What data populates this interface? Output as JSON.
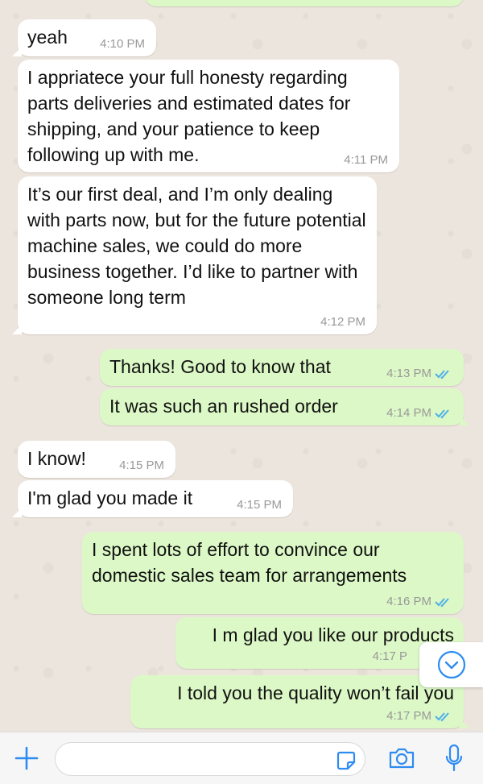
{
  "colors": {
    "background": "#ece5dd",
    "incoming_bubble": "#ffffff",
    "outgoing_bubble": "#dcf8c6",
    "read_ticks": "#4fb0e8",
    "accent": "#2d8cf0"
  },
  "messages": [
    {
      "direction": "in",
      "text": "yeah",
      "time": "4:10 PM"
    },
    {
      "direction": "in",
      "text": "I appriatece your full honesty regarding parts deliveries and estimated dates for shipping, and your patience to keep following up with me.",
      "time": "4:11 PM"
    },
    {
      "direction": "in",
      "text": "It’s our first deal, and I’m only dealing with parts now, but for the future potential machine sales, we could do more business together. I’d like to partner with someone long term",
      "time": "4:12 PM"
    },
    {
      "direction": "out",
      "text": "Thanks! Good to know that",
      "time": "4:13 PM",
      "status": "read"
    },
    {
      "direction": "out",
      "text": "It was such an rushed order",
      "time": "4:14 PM",
      "status": "read"
    },
    {
      "direction": "in",
      "text": "I know!",
      "time": "4:15 PM"
    },
    {
      "direction": "in",
      "text": "I'm glad you made it",
      "time": "4:15 PM"
    },
    {
      "direction": "out",
      "text": "I spent lots of effort to convince our domestic sales team for arrangements",
      "time": "4:16 PM",
      "status": "read"
    },
    {
      "direction": "out",
      "text": "I m glad you like our products",
      "time": "4:17 P",
      "status": "read"
    },
    {
      "direction": "out",
      "text": "I told you the quality won’t fail you",
      "time": "4:17 PM",
      "status": "read"
    }
  ],
  "composer": {
    "placeholder": "",
    "icons": [
      "plus-icon",
      "sticker-icon",
      "camera-icon",
      "microphone-icon"
    ]
  },
  "scroll_down_icon": "chevron-down-icon"
}
